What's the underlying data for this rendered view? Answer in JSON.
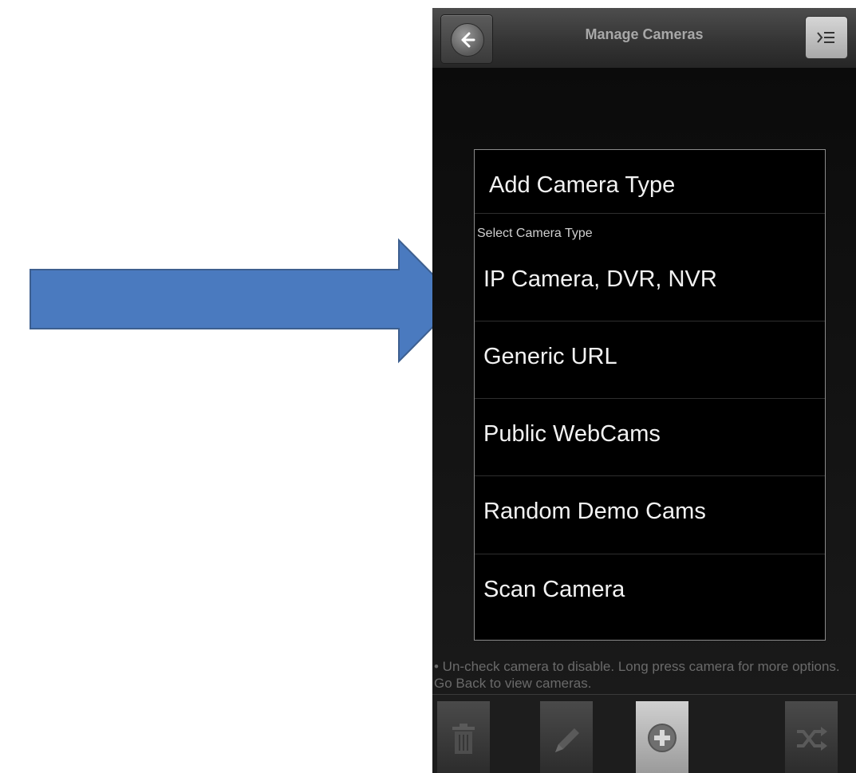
{
  "header": {
    "title": "Manage Cameras"
  },
  "dialog": {
    "title": "Add Camera Type",
    "subtitle": "Select Camera Type",
    "options": [
      {
        "label": "IP Camera, DVR, NVR"
      },
      {
        "label": "Generic URL"
      },
      {
        "label": "Public WebCams"
      },
      {
        "label": "Random Demo Cams"
      },
      {
        "label": "Scan Camera"
      }
    ]
  },
  "hint": {
    "text": "• Un-check camera to disable. Long press camera for more options. Go Back to view cameras."
  },
  "toolbar": {
    "buttons": [
      {
        "icon": "trash-icon",
        "active": false
      },
      {
        "icon": "pencil-icon",
        "active": false
      },
      {
        "icon": "add-circle-icon",
        "active": true
      },
      {
        "icon": "shuffle-icon",
        "active": false
      }
    ]
  },
  "annotation": {
    "arrow_color": "#4a7abf",
    "arrow_border": "#3d5f8f"
  }
}
